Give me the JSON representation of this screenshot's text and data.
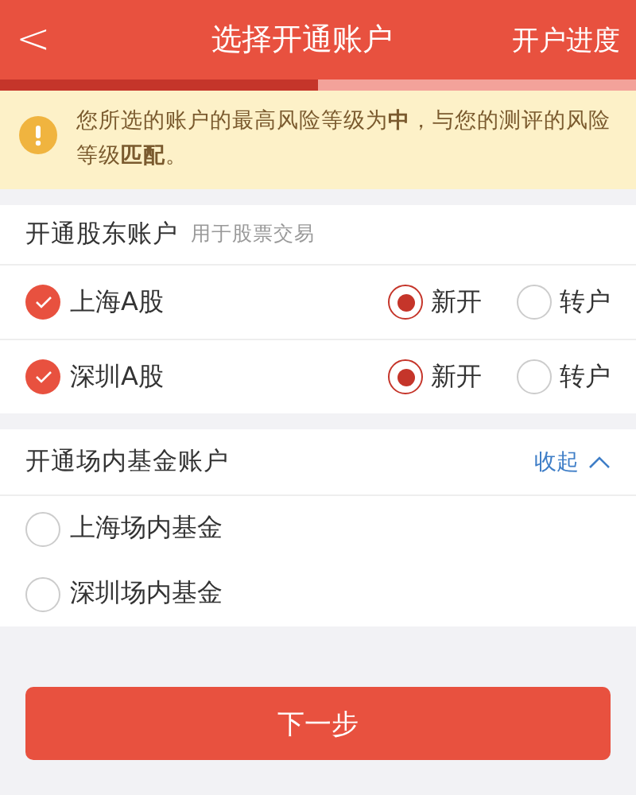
{
  "header": {
    "back": "<",
    "title": "选择开通账户",
    "action": "开户进度"
  },
  "progress": {
    "level": 0.5
  },
  "notice": {
    "text": "您所选的账户的最高风险等级为**中**，与您的测评的风险等级**匹配**。"
  },
  "stock_section": {
    "title": "开通股东账户",
    "hint": "用于股票交易",
    "rows": [
      {
        "label": "上海A股",
        "checked": true,
        "options": [
          {
            "label": "新开",
            "selected": true
          },
          {
            "label": "转户",
            "selected": false
          }
        ]
      },
      {
        "label": "深圳A股",
        "checked": true,
        "options": [
          {
            "label": "新开",
            "selected": true
          },
          {
            "label": "转户",
            "selected": false
          }
        ]
      }
    ]
  },
  "fund_section": {
    "title": "开通场内基金账户",
    "toggle": "收起",
    "expanded": true,
    "rows": [
      {
        "label": "上海场内基金",
        "checked": false
      },
      {
        "label": "深圳场内基金",
        "checked": false
      }
    ]
  },
  "next_button": "下一步"
}
